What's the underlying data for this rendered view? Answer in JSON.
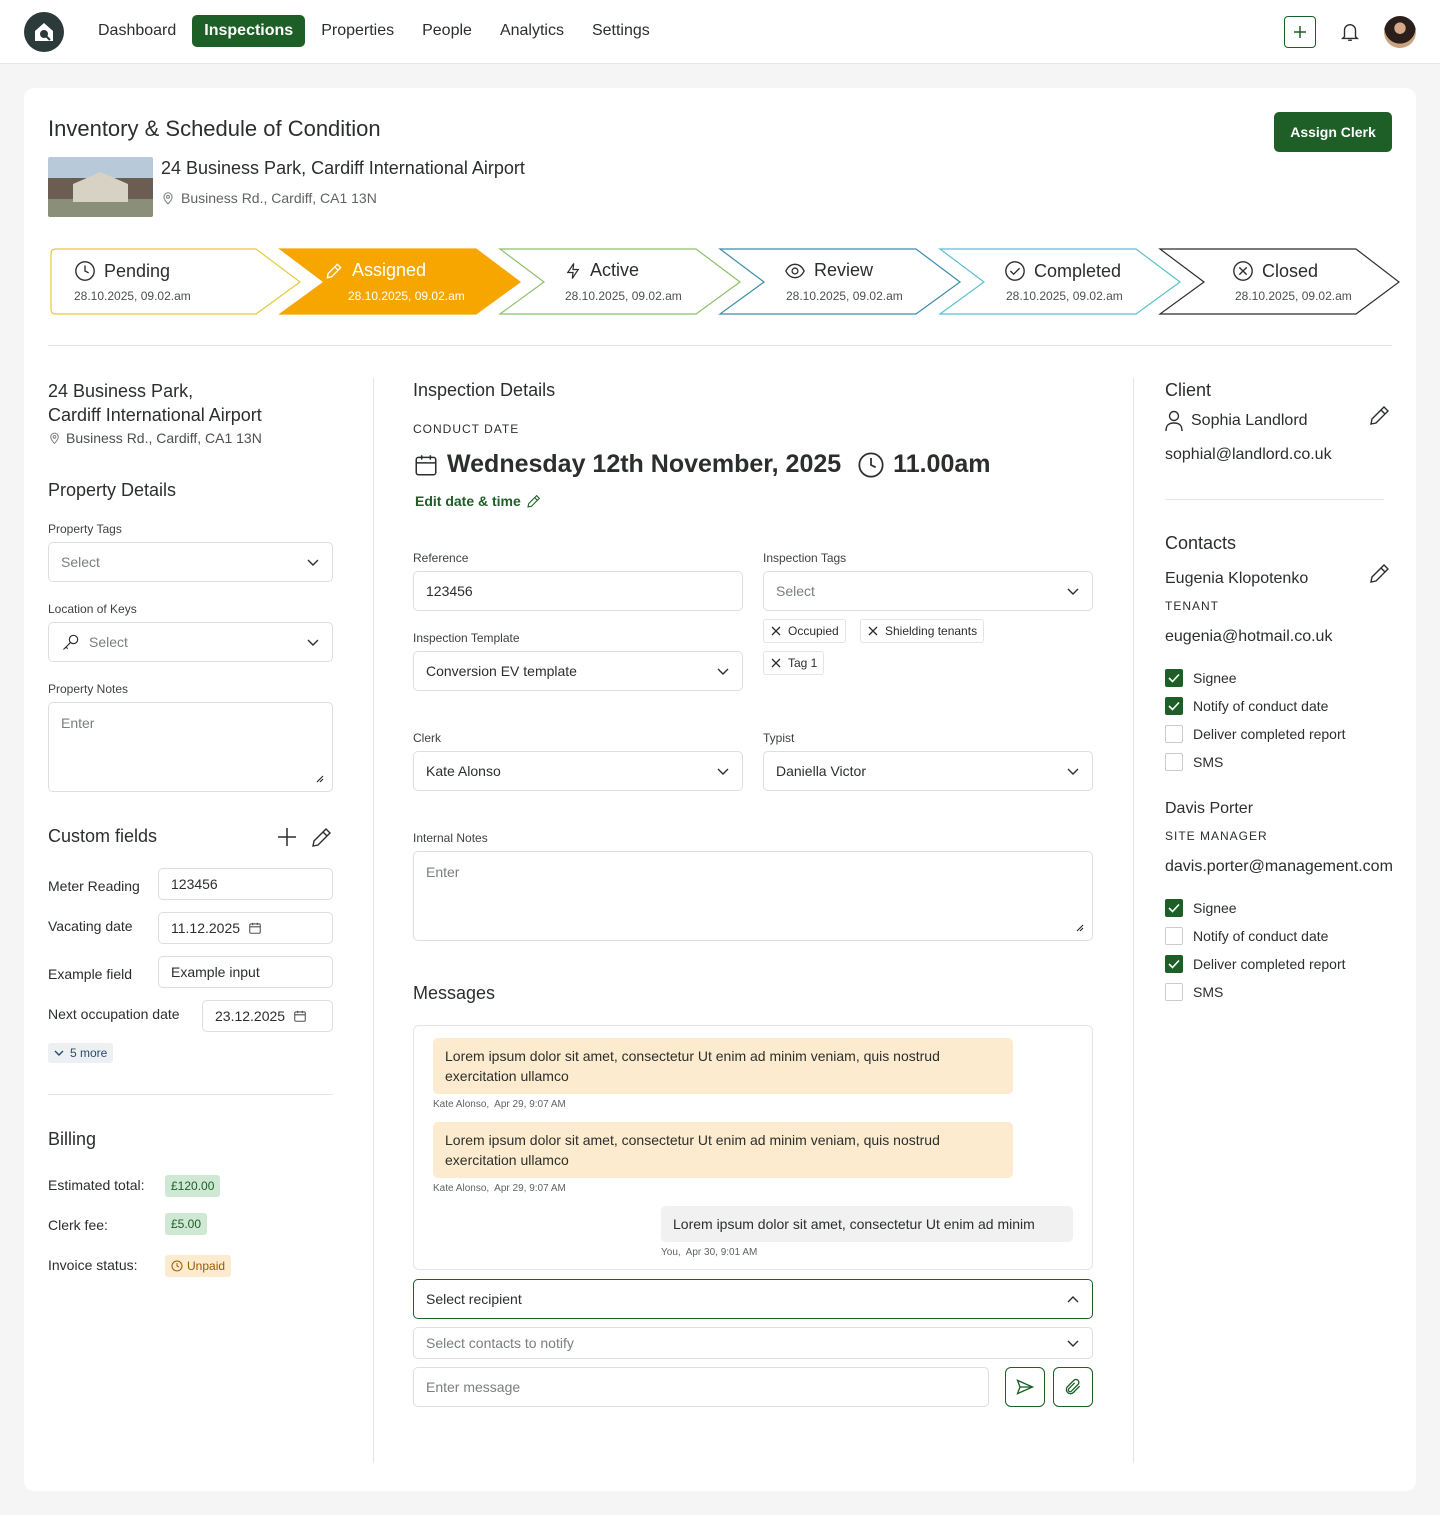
{
  "nav": {
    "items": [
      {
        "label": "Dashboard",
        "active": false
      },
      {
        "label": "Inspections",
        "active": true
      },
      {
        "label": "Properties",
        "active": false
      },
      {
        "label": "People",
        "active": false
      },
      {
        "label": "Analytics",
        "active": false
      },
      {
        "label": "Settings",
        "active": false
      }
    ]
  },
  "header": {
    "title": "Inventory & Schedule of Condition",
    "assign_label": "Assign Clerk",
    "address": "24 Business Park, Cardiff International Airport",
    "sub_address": "Business Rd., Cardiff, CA1 13N"
  },
  "steps": [
    {
      "label": "Pending",
      "date": "28.10.2025, 09.02.am",
      "icon": "clock-icon",
      "color": "#e8c93a"
    },
    {
      "label": "Assigned",
      "date": "28.10.2025, 09.02.am",
      "icon": "pencil-icon",
      "color": "#f7a600"
    },
    {
      "label": "Active",
      "date": "28.10.2025, 09.02.am",
      "icon": "lightning-icon",
      "color": "#8fbf6a"
    },
    {
      "label": "Review",
      "date": "28.10.2025, 09.02.am",
      "icon": "eye-icon",
      "color": "#3d8ca8"
    },
    {
      "label": "Completed",
      "date": "28.10.2025, 09.02.am",
      "icon": "check-circle-icon",
      "color": "#5cbfcf"
    },
    {
      "label": "Closed",
      "date": "28.10.2025, 09.02.am",
      "icon": "x-circle-icon",
      "color": "#2b2f2c"
    }
  ],
  "left": {
    "address_line1": "24 Business Park,",
    "address_line2": "Cardiff International Airport",
    "sub_address": "Business Rd., Cardiff, CA1 13N",
    "property_details_title": "Property Details",
    "property_tags_label": "Property Tags",
    "property_tags_value": "Select",
    "location_keys_label": "Location of Keys",
    "location_keys_value": "Select",
    "property_notes_label": "Property Notes",
    "property_notes_placeholder": "Enter",
    "custom_fields_title": "Custom fields",
    "fields": [
      {
        "label": "Meter Reading",
        "value": "123456"
      },
      {
        "label": "Vacating date",
        "value": "11.12.2025"
      },
      {
        "label": "Example field",
        "value": "Example input"
      },
      {
        "label": "Next occupation date",
        "value": "23.12.2025"
      }
    ],
    "more_label": "5 more",
    "billing_title": "Billing",
    "estimated_label": "Estimated total:",
    "estimated_value": "£120.00",
    "clerk_fee_label": "Clerk fee:",
    "clerk_fee_value": "£5.00",
    "invoice_label": "Invoice status:",
    "invoice_value": "Unpaid"
  },
  "middle": {
    "title": "Inspection Details",
    "conduct_label": "CONDUCT DATE",
    "conduct_date": "Wednesday 12th November, 2025",
    "conduct_time": "11.00am",
    "edit_label": "Edit date & time",
    "reference_label": "Reference",
    "reference_value": "123456",
    "inspection_tags_label": "Inspection Tags",
    "inspection_tags_value": "Select",
    "tags": [
      "Occupied",
      "Shielding tenants",
      "Tag 1"
    ],
    "template_label": "Inspection Template",
    "template_value": "Conversion EV template",
    "clerk_label": "Clerk",
    "clerk_value": "Kate Alonso",
    "typist_label": "Typist",
    "typist_value": "Daniella Victor",
    "internal_notes_label": "Internal Notes",
    "internal_notes_placeholder": "Enter",
    "messages_title": "Messages",
    "messages": [
      {
        "text": "Lorem ipsum dolor sit amet, consectetur Ut enim ad minim veniam, quis nostrud exercitation ullamco",
        "author": "Kate Alonso,",
        "time": "Apr 29, 9:07 AM"
      },
      {
        "text": "Lorem ipsum dolor sit amet, consectetur Ut enim ad minim veniam, quis nostrud exercitation ullamco",
        "author": "Kate Alonso,",
        "time": "Apr 29, 9:07 AM"
      },
      {
        "text": "Lorem ipsum dolor sit amet, consectetur Ut enim ad minim",
        "author": "You,",
        "time": "Apr 30, 9:01 AM"
      }
    ],
    "recipient_placeholder": "Select recipient",
    "notify_placeholder": "Select contacts to notify",
    "message_placeholder": "Enter message"
  },
  "right": {
    "client_title": "Client",
    "client_name": "Sophia Landlord",
    "client_email": "sophial@landlord.co.uk",
    "contacts_title": "Contacts",
    "contacts": [
      {
        "name": "Eugenia Klopotenko",
        "role": "TENANT",
        "email": "eugenia@hotmail.co.uk",
        "options": [
          {
            "label": "Signee",
            "checked": true
          },
          {
            "label": "Notify of conduct date",
            "checked": true
          },
          {
            "label": "Deliver completed report",
            "checked": false
          },
          {
            "label": "SMS",
            "checked": false
          }
        ]
      },
      {
        "name": "Davis Porter",
        "role": "SITE MANAGER",
        "email": "davis.porter@management.com",
        "options": [
          {
            "label": "Signee",
            "checked": true
          },
          {
            "label": "Notify of conduct date",
            "checked": false
          },
          {
            "label": "Deliver completed report",
            "checked": true
          },
          {
            "label": "SMS",
            "checked": false
          }
        ]
      }
    ]
  },
  "colors": {
    "brand": "#1e5e27",
    "accent": "#f7a600"
  }
}
